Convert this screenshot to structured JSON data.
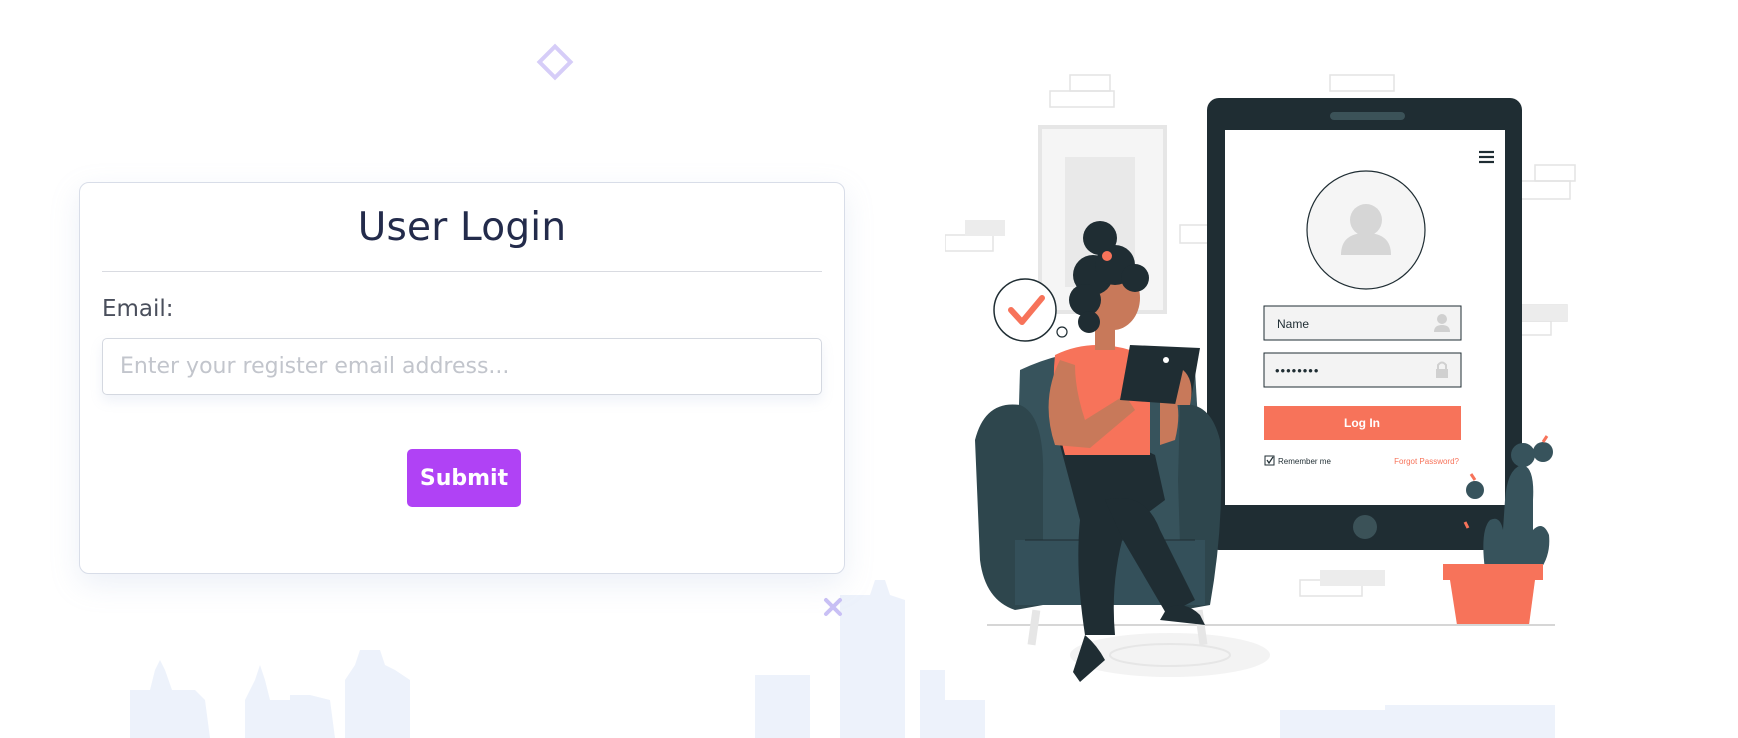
{
  "login": {
    "title": "User Login",
    "email_label": "Email:",
    "email_placeholder": "Enter your register email address...",
    "email_value": "",
    "submit_label": "Submit"
  },
  "illustration": {
    "name_field": "Name",
    "password_mask": "••••••••",
    "login_button": "Log In",
    "remember_me": "Remember me",
    "forgot_password": "Forgot Password?"
  },
  "colors": {
    "accent": "#b042f5",
    "title": "#232b4b",
    "illustration_coral": "#f7735a",
    "illustration_dark": "#1f2d33",
    "illustration_chair": "#37535c",
    "skyline": "#edf2fb"
  },
  "icons": [
    "diamond-icon",
    "cross-icon",
    "hamburger-menu-icon",
    "user-avatar-icon",
    "checkmark-icon",
    "lock-icon",
    "person-icon"
  ]
}
